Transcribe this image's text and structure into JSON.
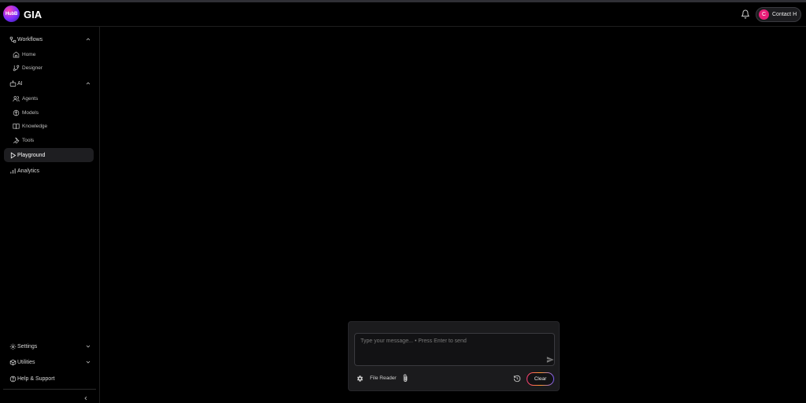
{
  "app": {
    "logo_text": "HubB",
    "title": "GIA"
  },
  "header": {
    "contact_initial": "C",
    "contact_label": "Contact H",
    "bell_icon": "bell-icon"
  },
  "sidebar": {
    "workflows": {
      "label": "Workflows",
      "items": [
        {
          "label": "Home",
          "icon": "home-icon"
        },
        {
          "label": "Designer",
          "icon": "designer-icon"
        }
      ]
    },
    "ai": {
      "label": "AI",
      "items": [
        {
          "label": "Agents",
          "icon": "agents-icon"
        },
        {
          "label": "Models",
          "icon": "models-icon"
        },
        {
          "label": "Knowledge",
          "icon": "knowledge-icon"
        },
        {
          "label": "Tools",
          "icon": "tools-icon"
        }
      ]
    },
    "playground": {
      "label": "Playground"
    },
    "analytics": {
      "label": "Analytics"
    },
    "settings": {
      "label": "Settings"
    },
    "utilities": {
      "label": "Utilities"
    },
    "help": {
      "label": "Help & Support"
    }
  },
  "chat": {
    "placeholder": "Type your message... • Press Enter to send",
    "file_reader_label": "File Reader",
    "clear_label": "Clear"
  },
  "colors": {
    "background": "#000000",
    "active_item": "#1e1e21",
    "avatar": "#e91e78",
    "panel": "#1b1b1d"
  }
}
